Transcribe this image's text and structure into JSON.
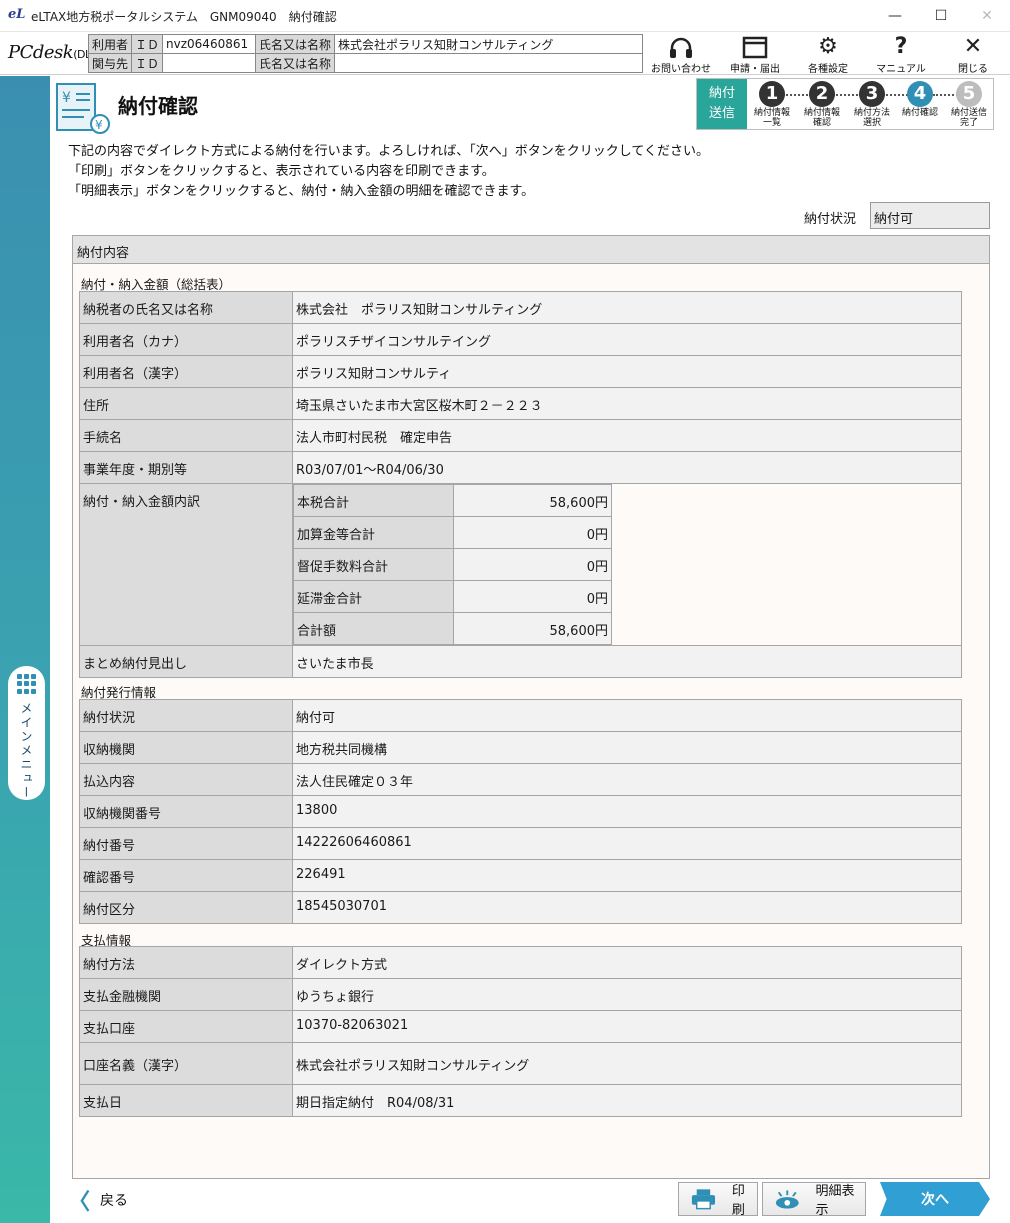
{
  "window": {
    "title": "eLTAX地方税ポータルシステム　GNM09040　納付確認",
    "logo": "eL",
    "minimize": "—",
    "maximize": "☐",
    "close": "✕"
  },
  "header": {
    "product_name": "PCdesk",
    "product_edition": "(DL版)",
    "user_rows": [
      {
        "label1": "利用者",
        "label2": "ＩＤ",
        "id": "nvz06460861",
        "name_label": "氏名又は名称",
        "name": "株式会社ポラリス知財コンサルティング"
      },
      {
        "label1": "関与先",
        "label2": "ＩＤ",
        "id": "",
        "name_label": "氏名又は名称",
        "name": ""
      }
    ],
    "toolbar": [
      {
        "icon": "headset-icon",
        "label": "お問い合わせ"
      },
      {
        "icon": "window-icon",
        "label": "申請・届出"
      },
      {
        "icon": "gear-icon",
        "label": "各種設定"
      },
      {
        "icon": "question-icon",
        "label": "マニュアル"
      },
      {
        "icon": "close-icon",
        "label": "閉じる"
      }
    ]
  },
  "sidebar": {
    "menu_label": "メインメニュー"
  },
  "page": {
    "title": "納付確認",
    "instructions": [
      "下記の内容でダイレクト方式による納付を行います。よろしければ、「次へ」ボタンをクリックしてください。",
      "「印刷」ボタンをクリックすると、表示されている内容を印刷できます。",
      "「明細表示」ボタンをクリックすると、納付・納入金額の明細を確認できます。"
    ],
    "status_label": "納付状況",
    "status_value": "納付可"
  },
  "stepper": {
    "current_line1": "納付",
    "current_line2": "送信",
    "steps": [
      {
        "num": "1",
        "label": "納付情報\n一覧",
        "state": "done"
      },
      {
        "num": "2",
        "label": "納付情報\n確認",
        "state": "done"
      },
      {
        "num": "3",
        "label": "納付方法\n選択",
        "state": "done"
      },
      {
        "num": "4",
        "label": "納付確認",
        "state": "current"
      },
      {
        "num": "5",
        "label": "納付送信\n完了",
        "state": "todo"
      }
    ]
  },
  "panel": {
    "title": "納付内容",
    "summary_title": "納付・納入金額（総括表）",
    "summary_rows": [
      {
        "key": "納税者の氏名又は名称",
        "value": "株式会社　ポラリス知財コンサルティング"
      },
      {
        "key": "利用者名（カナ）",
        "value": "ポラリスチザイコンサルテイング"
      },
      {
        "key": "利用者名（漢字）",
        "value": "ポラリス知財コンサルティ"
      },
      {
        "key": "住所",
        "value": "埼玉県さいたま市大宮区桜木町２－２２３"
      },
      {
        "key": "手続名",
        "value": "法人市町村民税　確定申告"
      },
      {
        "key": "事業年度・期別等",
        "value": "R03/07/01～R04/06/30"
      }
    ],
    "breakdown_key": "納付・納入金額内訳",
    "breakdown": [
      {
        "key": "本税合計",
        "value": "58,600円"
      },
      {
        "key": "加算金等合計",
        "value": "0円"
      },
      {
        "key": "督促手数料合計",
        "value": "0円"
      },
      {
        "key": "延滞金合計",
        "value": "0円"
      },
      {
        "key": "合計額",
        "value": "58,600円"
      }
    ],
    "matome_key": "まとめ納付見出し",
    "matome_value": "さいたま市長",
    "issue_title": "納付発行情報",
    "issue_rows": [
      {
        "key": "納付状況",
        "value": "納付可"
      },
      {
        "key": "収納機関",
        "value": "地方税共同機構"
      },
      {
        "key": "払込内容",
        "value": "法人住民確定０３年"
      },
      {
        "key": "収納機関番号",
        "value": "13800"
      },
      {
        "key": "納付番号",
        "value": "14222606460861"
      },
      {
        "key": "確認番号",
        "value": "226491"
      },
      {
        "key": "納付区分",
        "value": "18545030701"
      }
    ],
    "payment_title": "支払情報",
    "payment_rows": [
      {
        "key": "納付方法",
        "value": "ダイレクト方式"
      },
      {
        "key": "支払金融機関",
        "value": "ゆうちょ銀行"
      },
      {
        "key": "支払口座",
        "value": "10370-82063021"
      },
      {
        "key": "口座名義（漢字）",
        "value": "株式会社ポラリス知財コンサルティング"
      },
      {
        "key": "支払日",
        "value": "期日指定納付　R04/08/31"
      }
    ]
  },
  "footer": {
    "back_label": "戻る",
    "print_label": "印刷",
    "detail_label": "明細表示",
    "next_label": "次へ"
  },
  "colors": {
    "accent": "#2f8fb5",
    "step_current_bg": "#2aa59a",
    "next_button": "#2f9fd4"
  }
}
